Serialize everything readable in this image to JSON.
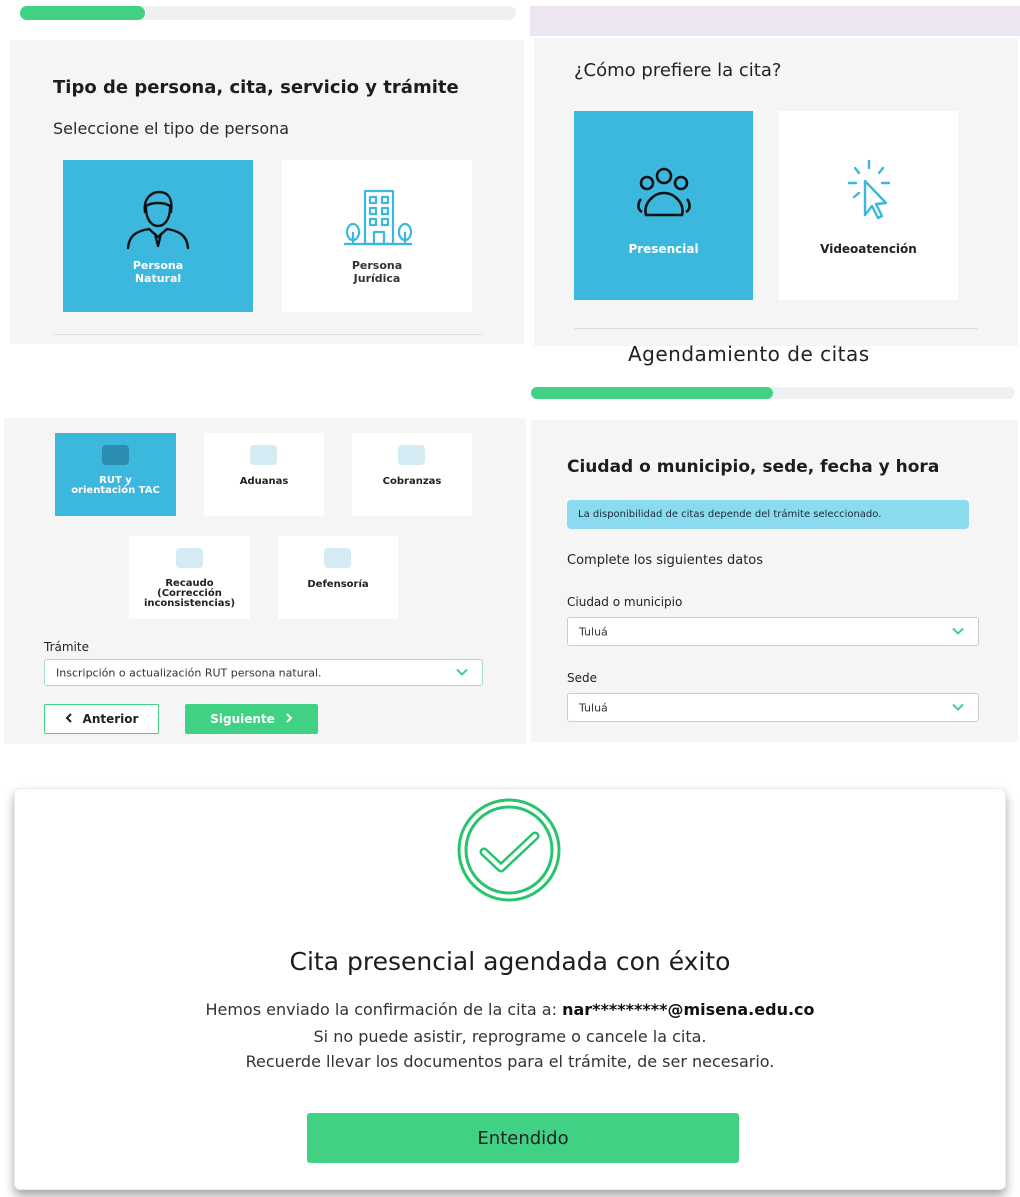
{
  "panel_persona": {
    "progress": 0.25,
    "title": "Tipo de persona, cita, servicio y trámite",
    "subtitle": "Seleccione el tipo de persona",
    "options": [
      {
        "label_line1": "Persona",
        "label_line2": "Natural",
        "icon": "person-user-icon",
        "selected": true
      },
      {
        "label_line1": "Persona",
        "label_line2": "Jurídica",
        "icon": "building-icon",
        "selected": false
      }
    ]
  },
  "panel_cita": {
    "question": "¿Cómo prefiere la cita?",
    "options": [
      {
        "label": "Presencial",
        "icon": "group-people-icon",
        "selected": true
      },
      {
        "label": "Videoatención",
        "icon": "cursor-click-icon",
        "selected": false
      }
    ],
    "section_title": "Agendamiento de citas",
    "progress": 0.5
  },
  "panel_servicio": {
    "services": [
      {
        "label_line1": "RUT y",
        "label_line2": "orientación TAC",
        "label_line3": "",
        "selected": true
      },
      {
        "label_line1": "Aduanas",
        "label_line2": "",
        "label_line3": "",
        "selected": false
      },
      {
        "label_line1": "Cobranzas",
        "label_line2": "",
        "label_line3": "",
        "selected": false
      },
      {
        "label_line1": "Recaudo",
        "label_line2": "(Corrección",
        "label_line3": "inconsistencias)",
        "selected": false
      },
      {
        "label_line1": "Defensoría",
        "label_line2": "",
        "label_line3": "",
        "selected": false
      }
    ],
    "tramite_label": "Trámite",
    "tramite_value": "Inscripción o actualización RUT persona natural.",
    "prev_button": "Anterior",
    "next_button": "Siguiente"
  },
  "panel_ubicacion": {
    "title": "Ciudad o municipio, sede, fecha y hora",
    "info": "La disponibilidad de citas depende del trámite seleccionado.",
    "subtitle": "Complete los siguientes datos",
    "city_label": "Ciudad o municipio",
    "city_value": "Tuluá",
    "sede_label": "Sede",
    "sede_value": "Tuluá"
  },
  "confirmation": {
    "title": "Cita presencial agendada con éxito",
    "line1_prefix": "Hemos enviado la confirmación de la cita a:",
    "email": "nar*********@misena.edu.co",
    "line2": "Si no puede asistir, reprograme o cancele la cita.",
    "line3": "Recuerde llevar los documentos para el trámite, de ser necesario.",
    "button": "Entendido"
  },
  "colors": {
    "accent_blue": "#3cb7de",
    "accent_green": "#41d185",
    "info_bg": "#8adaf0"
  }
}
